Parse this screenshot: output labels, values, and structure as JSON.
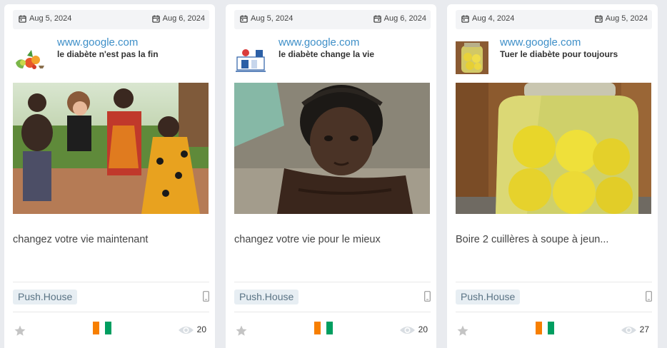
{
  "colors": {
    "link": "#3e8fc8",
    "tag_bg": "#e7eef3",
    "page_bg": "#e9ebef"
  },
  "icons": {
    "date": "calendar-icon",
    "device": "mobile-icon",
    "favorite": "star-icon",
    "country": "cote-divoire-flag-icon",
    "views": "eye-icon"
  },
  "cards": [
    {
      "date_start": "Aug 5, 2024",
      "date_end": "Aug 6, 2024",
      "domain": "www.google.com",
      "headline": "le diabète n'est pas la fin",
      "description": "changez votre vie maintenant",
      "network": "Push.House",
      "views": "20"
    },
    {
      "date_start": "Aug 5, 2024",
      "date_end": "Aug 6, 2024",
      "domain": "www.google.com",
      "headline": "le diabète change la vie",
      "description": "changez votre vie pour le mieux",
      "network": "Push.House",
      "views": "20"
    },
    {
      "date_start": "Aug 4, 2024",
      "date_end": "Aug 5, 2024",
      "domain": "www.google.com",
      "headline": "Tuer le diabète pour toujours",
      "description": "Boire 2 cuillères à soupe à jeun...",
      "network": "Push.House",
      "views": "27"
    }
  ]
}
